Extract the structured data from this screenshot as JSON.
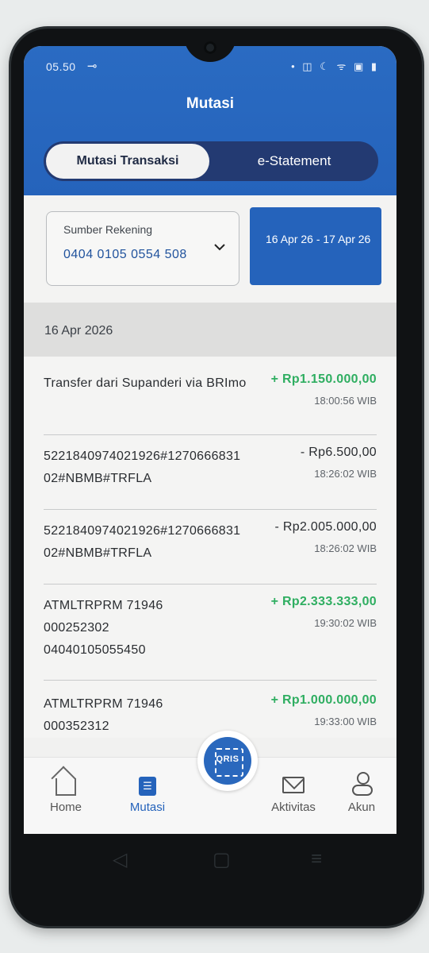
{
  "status": {
    "time": "05.50",
    "key_icon": "key-icon",
    "right_icons": "• ◫ ☾ ᯤ ▣ ▮"
  },
  "header": {
    "title": "Mutasi",
    "tabs": [
      "Mutasi Transaksi",
      "e-Statement"
    ],
    "active_tab": "Mutasi Transaksi"
  },
  "filters": {
    "source_label": "Sumber Rekening",
    "source_value": "0404 0105 0554 508",
    "date_range": "16 Apr 26 - 17 Apr 26"
  },
  "date_group": "16 Apr 2026",
  "transactions": [
    {
      "desc": "Transfer dari Supanderi via BRImo",
      "amount": "+ Rp1.150.000,00",
      "time": "18:00:56 WIB",
      "type": "credit"
    },
    {
      "desc": "5221840974021926#127066683102#NBMB#TRFLA",
      "amount": "- Rp6.500,00",
      "time": "18:26:02 WIB",
      "type": "debit"
    },
    {
      "desc": "5221840974021926#127066683102#NBMB#TRFLA",
      "amount": "- Rp2.005.000,00",
      "time": "18:26:02 WIB",
      "type": "debit"
    },
    {
      "desc": "ATMLTRPRM 71946 000252302 04040105055450",
      "amount": "+ Rp2.333.333,00",
      "time": "19:30:02 WIB",
      "type": "credit"
    },
    {
      "desc": "ATMLTRPRM 71946 000352312",
      "amount": "+ Rp1.000.000,00",
      "time": "19:33:00 WIB",
      "type": "credit"
    }
  ],
  "nav": {
    "items": [
      {
        "label": "Home",
        "icon": "home-icon"
      },
      {
        "label": "Mutasi",
        "icon": "list-icon"
      },
      {
        "label": "Aktivitas",
        "icon": "mail-icon"
      },
      {
        "label": "Akun",
        "icon": "user-icon"
      }
    ],
    "active": "Mutasi",
    "qris_label": "QRIS"
  },
  "colors": {
    "brand_blue": "#2563bb",
    "segment_dark": "#233a72",
    "credit_green": "#2fae61"
  }
}
